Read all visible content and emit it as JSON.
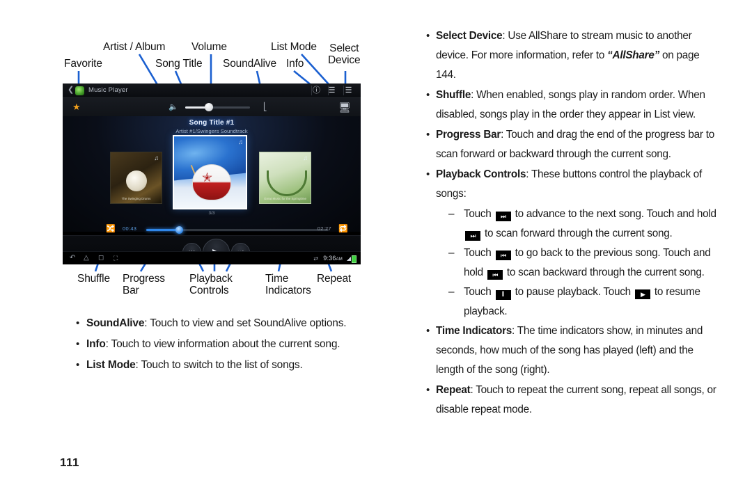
{
  "page": {
    "number": "111"
  },
  "callouts": [
    {
      "id": "favorite",
      "label": "Favorite"
    },
    {
      "id": "artist-album",
      "label": "Artist / Album"
    },
    {
      "id": "song-title",
      "label": "Song Title"
    },
    {
      "id": "volume",
      "label": "Volume"
    },
    {
      "id": "soundalive",
      "label": "SoundAlive"
    },
    {
      "id": "info",
      "label": "Info"
    },
    {
      "id": "list-mode",
      "label": "List Mode"
    },
    {
      "id": "select-device",
      "label": "Select\nDevice"
    },
    {
      "id": "shuffle",
      "label": "Shuffle"
    },
    {
      "id": "progress-bar",
      "label": "Progress\nBar"
    },
    {
      "id": "playback-controls",
      "label": "Playback\nControls"
    },
    {
      "id": "time-indicators",
      "label": "Time\nIndicators"
    },
    {
      "id": "repeat",
      "label": "Repeat"
    }
  ],
  "callout_line_color": "#1a5fd0",
  "device": {
    "action_bar": {
      "back_icon": "back-chevron-icon",
      "app_icon": "music-player-app-icon",
      "title": "Music Player",
      "info_icon": "info-icon",
      "list_mode_icon": "list-mode-icon",
      "menu_icon": "overflow-menu-icon"
    },
    "sub_bar": {
      "favorite_icon": "star-icon",
      "mute_icon": "speaker-mute-icon",
      "volume_percent": 35,
      "soundalive_icon": "soundalive-equalizer-icon",
      "select_device_icon": "select-device-icon"
    },
    "now_playing": {
      "song_title": "Song Title #1",
      "artist_album": "Artist #1/Swingers Soundtrack",
      "carousel_counter": "3/3",
      "prev_album_caption": "The Swinging Drums",
      "next_album_caption": "Great Music for the Springtime",
      "note_icon": "music-note-icon"
    },
    "progress": {
      "shuffle_icon": "shuffle-icon",
      "elapsed_time": "00:43",
      "total_time": "02:27",
      "repeat_icon": "repeat-icon",
      "percent": 18
    },
    "playback": {
      "previous_icon": "skip-previous-icon",
      "play_icon": "play-icon",
      "next_icon": "skip-next-icon",
      "previous_glyph": "⏮",
      "play_glyph": "▶",
      "next_glyph": "⏭"
    },
    "system_bar": {
      "back_icon": "system-back-icon",
      "home_icon": "system-home-icon",
      "recent_icon": "system-recent-apps-icon",
      "screenshot_icon": "system-screenshot-icon",
      "sync_icon": "sync-icon",
      "clock": "9:36",
      "clock_ampm": "AM",
      "wifi_icon": "wifi-icon",
      "battery_icon": "battery-icon"
    }
  },
  "left_bullets": [
    {
      "term": "SoundAlive",
      "rest": ": Touch to view and set SoundAlive options."
    },
    {
      "term": "Info",
      "rest": ": Touch to view information about the current song."
    },
    {
      "term": "List Mode",
      "rest": ": Touch to switch to the list of songs."
    }
  ],
  "right_column": {
    "select_device": {
      "term": "Select Device",
      "part1": ": Use AllShare to stream music to another device. For more information, refer to ",
      "italic": "“AllShare”",
      "part2": " on page 144."
    },
    "shuffle": {
      "term": "Shuffle",
      "rest": ": When enabled, songs play in random order. When disabled, songs play in the order they appear in List view."
    },
    "progress_bar": {
      "term": "Progress Bar",
      "rest": ": Touch and drag the end of the progress bar to scan forward or backward through the current song."
    },
    "playback_controls": {
      "term": "Playback Controls",
      "rest": ": These buttons control the playback of songs:"
    },
    "sub_next": {
      "p1": "Touch ",
      "g1": "⏭",
      "p2": " to advance to the next song. Touch and hold ",
      "g2": "⏭",
      "p3": " to scan forward through the current song."
    },
    "sub_prev": {
      "p1": "Touch ",
      "g1": "⏮",
      "p2": " to go back to the previous song. Touch and hold ",
      "g2": "⏮",
      "p3": " to scan backward through the current song."
    },
    "sub_pause": {
      "p1": "Touch ",
      "g1": "‖",
      "p2": " to pause playback. Touch ",
      "g2": "▶",
      "p3": " to resume playback."
    },
    "time_indicators": {
      "term": "Time Indicators",
      "rest": ": The time indicators show, in minutes and seconds, how much of the song has played (left) and the length of the song (right)."
    },
    "repeat": {
      "term": "Repeat",
      "rest": ": Touch to repeat the current song, repeat all songs, or disable repeat mode."
    }
  }
}
